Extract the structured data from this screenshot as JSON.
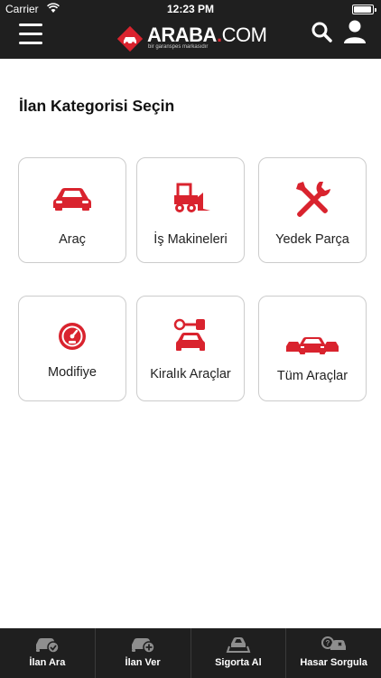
{
  "status_bar": {
    "carrier": "Carrier",
    "time": "12:23 PM"
  },
  "header": {
    "logo_brand": "ARABA",
    "logo_dot": ".",
    "logo_com": "COM",
    "logo_tagline": "bir garanspes markasıdır"
  },
  "page": {
    "title": "İlan Kategorisi Seçin"
  },
  "categories": [
    {
      "label": "Araç",
      "icon": "car-icon"
    },
    {
      "label": "İş Makineleri",
      "icon": "construction-machine-icon"
    },
    {
      "label": "Yedek Parça",
      "icon": "tools-icon"
    },
    {
      "label": "Modifiye",
      "icon": "speedometer-icon"
    },
    {
      "label": "Kiralık Araçlar",
      "icon": "rental-car-key-icon"
    },
    {
      "label": "Tüm Araçlar",
      "icon": "all-cars-icon"
    }
  ],
  "tabbar": {
    "items": [
      {
        "label": "İlan Ara",
        "icon": "search-car-icon"
      },
      {
        "label": "İlan Ver",
        "icon": "add-car-icon"
      },
      {
        "label": "Sigorta Al",
        "icon": "insurance-car-icon"
      },
      {
        "label": "Hasar Sorgula",
        "icon": "damage-query-icon"
      }
    ]
  },
  "colors": {
    "accent": "#d9232e",
    "bar_background": "#1f1f1f",
    "card_border": "#cccccc"
  }
}
